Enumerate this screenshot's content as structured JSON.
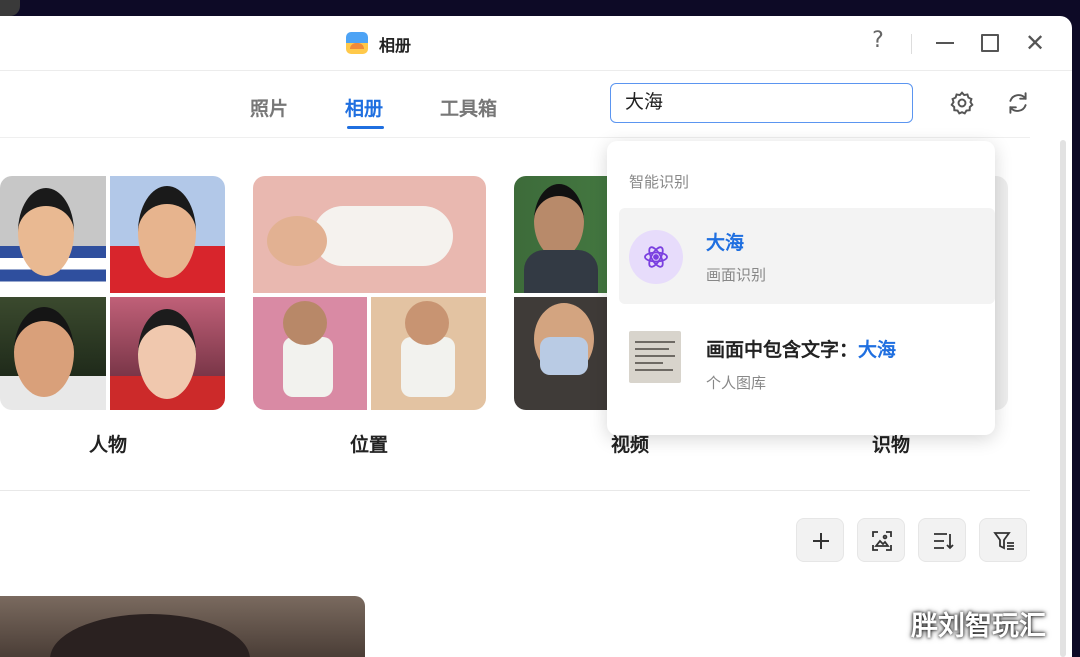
{
  "titlebar": {
    "app_title": "相册",
    "help_label": "?",
    "close_label": "✕"
  },
  "tabs": [
    {
      "label": "照片",
      "active": false
    },
    {
      "label": "相册",
      "active": true
    },
    {
      "label": "工具箱",
      "active": false
    }
  ],
  "search": {
    "value": "大海"
  },
  "categories": [
    {
      "label": "人物"
    },
    {
      "label": "位置"
    },
    {
      "label": "视频"
    },
    {
      "label": "识物"
    }
  ],
  "dropdown": {
    "header": "智能识别",
    "items": [
      {
        "title": "大海",
        "subtitle": "画面识别",
        "icon": "atom-icon"
      },
      {
        "title_prefix": "画面中包含文字：",
        "title_highlight": "大海",
        "subtitle": "个人图库",
        "icon": "document-thumbnail"
      }
    ]
  },
  "toolbar_icons": [
    "add-icon",
    "scan-image-icon",
    "sort-icon",
    "filter-icon"
  ],
  "watermark": "胖刘智玩汇",
  "colors": {
    "accent": "#1f6fe0",
    "atom_bg": "#e7dcfb",
    "atom": "#7a3fe0"
  }
}
